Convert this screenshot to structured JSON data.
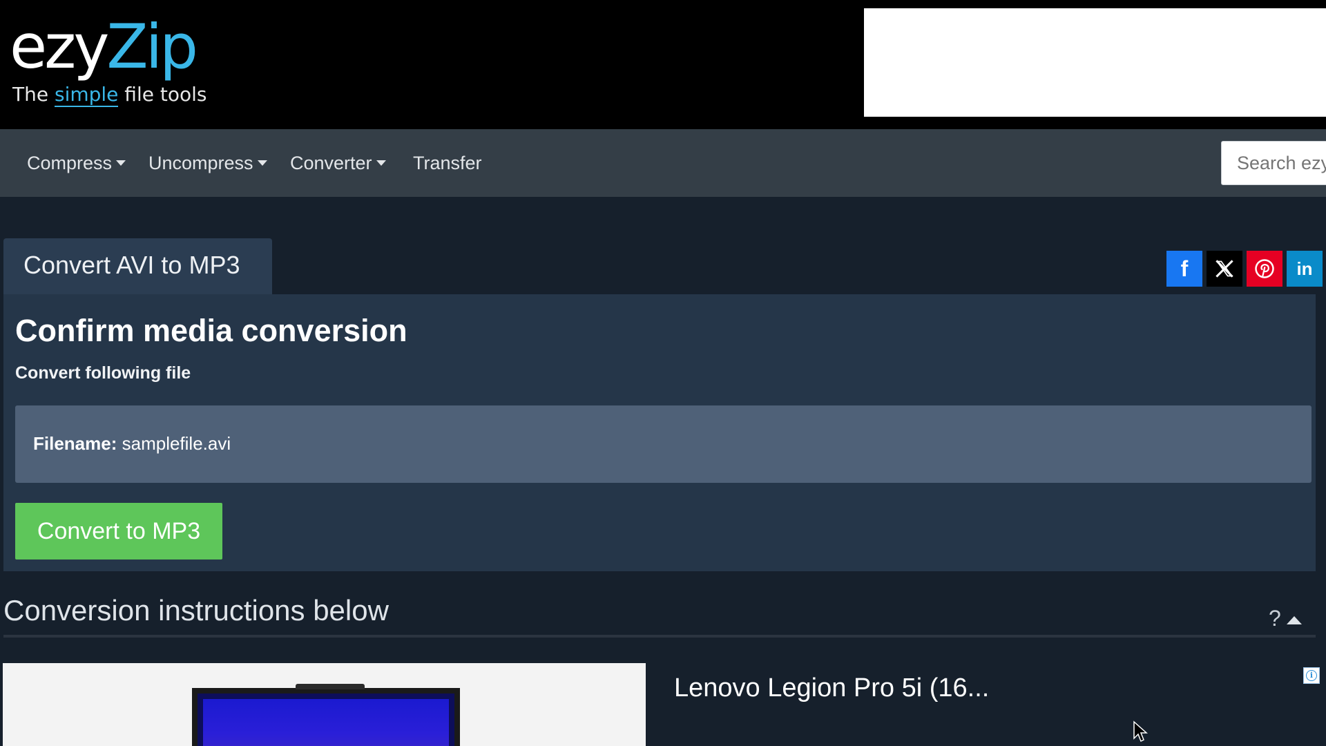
{
  "header": {
    "logo": {
      "brand_part1": "ezy",
      "brand_part2": "Zip",
      "tagline_pre": "The ",
      "tagline_highlight": "simple",
      "tagline_post": " file tools"
    },
    "nav": [
      {
        "label": "Compress",
        "dropdown": true
      },
      {
        "label": "Uncompress",
        "dropdown": true
      },
      {
        "label": "Converter",
        "dropdown": true
      },
      {
        "label": "Transfer",
        "dropdown": false
      }
    ],
    "search": {
      "placeholder": "Search ezy"
    }
  },
  "tab": {
    "label": "Convert AVI to MP3"
  },
  "share": [
    {
      "name": "facebook-icon",
      "glyph": "f",
      "color": "#1877f2"
    },
    {
      "name": "x-icon",
      "glyph": "𝕏",
      "color": "#000000"
    },
    {
      "name": "pinterest-icon",
      "glyph": "P",
      "color": "#e60023"
    },
    {
      "name": "linkedin-icon",
      "glyph": "in",
      "color": "#0a8bc9"
    }
  ],
  "panel": {
    "title": "Confirm media conversion",
    "subtitle": "Convert following file",
    "filename_label": "Filename:",
    "filename_value": "samplefile.avi",
    "convert_button": "Convert to MP3"
  },
  "instructions": {
    "heading": "Conversion instructions below",
    "help": "?"
  },
  "ad": {
    "title": "Lenovo Legion Pro 5i (16..."
  },
  "colors": {
    "accent": "#3ab7e8",
    "convert_button": "#5ec65a",
    "navbar": "#343e47",
    "panel": "#253649"
  }
}
